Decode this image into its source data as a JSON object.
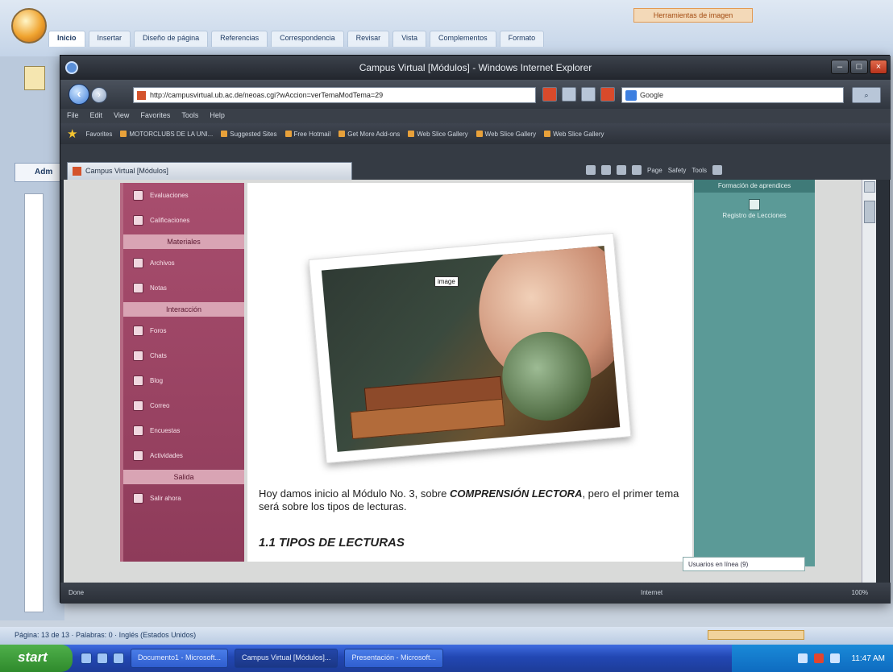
{
  "word": {
    "tabs": [
      "Inicio",
      "Insertar",
      "Diseño de página",
      "Referencias",
      "Correspondencia",
      "Revisar",
      "Vista",
      "Complementos",
      "Formato"
    ],
    "tools_title": "Herramientas de imagen",
    "doc_tab": "Adm",
    "status": "Página: 13 de 13 · Palabras: 0 · Inglés (Estados Unidos)"
  },
  "ie": {
    "title": "Campus Virtual [Módulos] - Windows Internet Explorer",
    "address": "http://campusvirtual.ub.ac.de/neoas.cgi?wAccion=verTemaModTema=29",
    "search_placeholder": "Google",
    "search_go": "",
    "menu": [
      "File",
      "Edit",
      "View",
      "Favorites",
      "Tools",
      "Help"
    ],
    "favorites": [
      "Favorites",
      "MOTORCLUBS DE LA UNI...",
      "Suggested Sites",
      "Free Hotmail",
      "Get More Add-ons",
      "Web Slice Gallery",
      "Web Slice Gallery",
      "Web Slice Gallery"
    ],
    "tab_title": "Campus Virtual [Módulos]",
    "commands": [
      "Page",
      "Safety",
      "Tools"
    ],
    "status_done": "Done",
    "status_zone": "Internet",
    "status_zoom": "100%"
  },
  "sidebar": {
    "groups": [
      {
        "items": [
          "Evaluaciones",
          "Calificaciones"
        ]
      },
      {
        "heading": "Materiales",
        "items": [
          "Archivos",
          "Notas"
        ]
      },
      {
        "heading": "Interacción",
        "items": [
          "Foros",
          "Chats",
          "Blog",
          "Correo",
          "Encuestas",
          "Actividades"
        ]
      },
      {
        "heading": "Salida",
        "items": [
          "Salir ahora"
        ]
      }
    ]
  },
  "content": {
    "image_label": "image",
    "paragraph_prefix": "Hoy damos inicio al Módulo No. 3, sobre ",
    "paragraph_strong": "COMPRENSIÓN LECTORA",
    "paragraph_suffix": ", pero el primer tema será sobre los tipos de lecturas.",
    "heading": "1.1 TIPOS DE LECTURAS"
  },
  "right_panel": {
    "heading": "Formación de aprendices",
    "label": "Registro de Lecciones",
    "online": "Usuarios en línea (9)"
  },
  "taskbar": {
    "start": "start",
    "items": [
      "Documento1 - Microsoft...",
      "Campus Virtual [Módulos]...",
      "Presentación - Microsoft..."
    ],
    "clock": "11:47 AM"
  },
  "colors": {
    "menu_bg": "#9b4465",
    "right_panel": "#5b9a97",
    "ie_chrome": "#2a3038"
  }
}
